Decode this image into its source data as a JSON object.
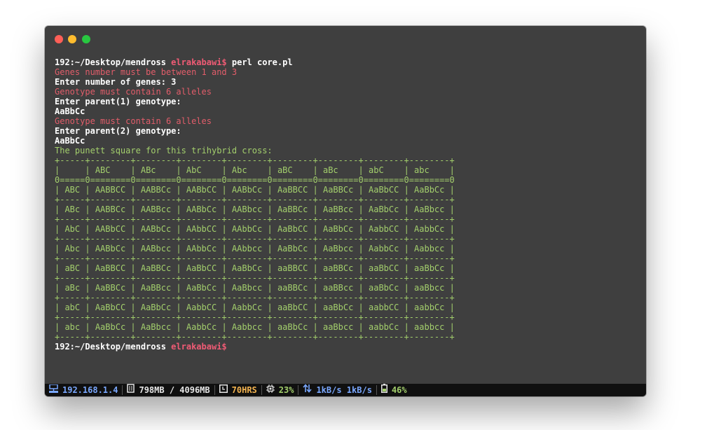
{
  "prompt": {
    "host_path": "192:~/Desktop/mendross ",
    "user": "elrakabawi$",
    "command": " perl core.pl"
  },
  "session": [
    {
      "text": "Genes number must be between 1 and 3",
      "style": "err"
    },
    {
      "text": "Enter number of genes: 3",
      "style": "bold"
    },
    {
      "text": "Genotype must contain 6 alleles",
      "style": "err"
    },
    {
      "text": "Enter parent(1) genotype:",
      "style": "bold"
    },
    {
      "text": "AaBbCc",
      "style": "bold"
    },
    {
      "text": "Genotype must contain 6 alleles",
      "style": "err"
    },
    {
      "text": "Enter parent(2) genotype:",
      "style": "bold"
    },
    {
      "text": "AaBbCc",
      "style": "bold"
    },
    {
      "text": "The punett square for this trihybrid cross:",
      "style": "out"
    }
  ],
  "punnett": {
    "header": [
      "ABC",
      "ABc",
      "AbC",
      "Abc",
      "aBC",
      "aBc",
      "abC",
      "abc"
    ],
    "rows": [
      {
        "gamete": "ABC",
        "cells": [
          "AABBCC",
          "AABBCc",
          "AABbCC",
          "AABbCc",
          "AaBBCC",
          "AaBBCc",
          "AaBbCC",
          "AaBbCc"
        ]
      },
      {
        "gamete": "ABc",
        "cells": [
          "AABBCc",
          "AABBcc",
          "AABbCc",
          "AABbcc",
          "AaBBCc",
          "AaBBcc",
          "AaBbCc",
          "AaBbcc"
        ]
      },
      {
        "gamete": "AbC",
        "cells": [
          "AABbCC",
          "AABbCc",
          "AAbbCC",
          "AAbbCc",
          "AaBbCC",
          "AaBbCc",
          "AabbCC",
          "AabbCc"
        ]
      },
      {
        "gamete": "Abc",
        "cells": [
          "AABbCc",
          "AABbcc",
          "AAbbCc",
          "AAbbcc",
          "AaBbCc",
          "AaBbcc",
          "AabbCc",
          "Aabbcc"
        ]
      },
      {
        "gamete": "aBC",
        "cells": [
          "AaBBCC",
          "AaBBCc",
          "AaBbCC",
          "AaBbCc",
          "aaBBCC",
          "aaBBCc",
          "aaBbCC",
          "aaBbCc"
        ]
      },
      {
        "gamete": "aBc",
        "cells": [
          "AaBBCc",
          "AaBBcc",
          "AaBbCc",
          "AaBbcc",
          "aaBBCc",
          "aaBBcc",
          "aaBbCc",
          "aaBbcc"
        ]
      },
      {
        "gamete": "abC",
        "cells": [
          "AaBbCC",
          "AaBbCc",
          "AabbCC",
          "AabbCc",
          "aaBbCC",
          "aaBbCc",
          "aabbCC",
          "aabbCc"
        ]
      },
      {
        "gamete": "abc",
        "cells": [
          "AaBbCc",
          "AaBbcc",
          "AabbCc",
          "Aabbcc",
          "aaBbCc",
          "aaBbcc",
          "aabbCc",
          "aabbcc"
        ]
      }
    ]
  },
  "final_prompt": {
    "host_path": "192:~/Desktop/mendross ",
    "user": "elrakabawi$"
  },
  "statusbar": {
    "ip": "192.168.1.4",
    "memory": "798MB / 4096MB",
    "uptime": "70HRS",
    "cpu": "23%",
    "network": "1kB/s 1kB/s",
    "battery": "46%"
  },
  "icons": {
    "network": "network-icon",
    "memory": "memory-icon",
    "uptime": "clock-icon",
    "cpu": "cpu-icon",
    "traffic": "up-down-arrows-icon",
    "battery": "battery-icon"
  },
  "colors": {
    "background": "#3f3f3f",
    "error": "#e25d6a",
    "output": "#a3cf6c",
    "user": "#f05b75",
    "ip": "#7aa8ff",
    "uptime": "#f4b450"
  }
}
